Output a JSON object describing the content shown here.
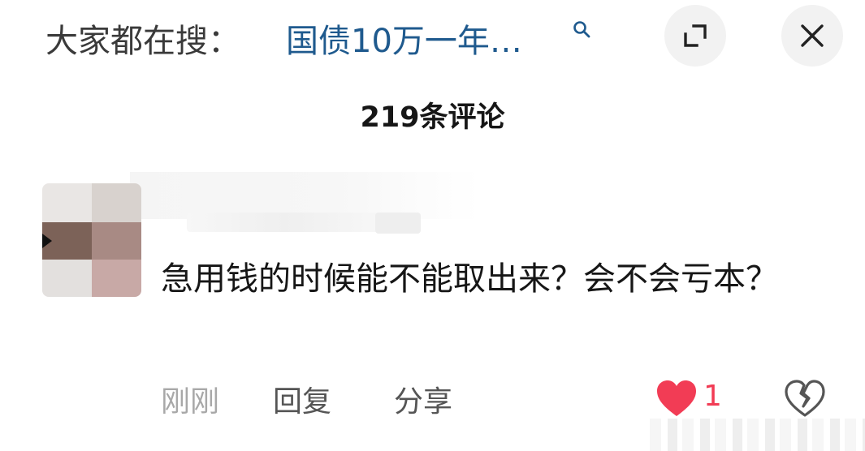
{
  "header": {
    "search_prefix": "大家都在搜：",
    "search_query": "国债10万一年…",
    "search_icon": "search-icon",
    "expand_icon": "expand-icon",
    "close_icon": "close-icon"
  },
  "comments_header": {
    "count_label": "219条评论"
  },
  "comment": {
    "avatar_icon": "avatar",
    "text": "急用钱的时候能不能取出来？会不会亏本？",
    "time": "刚刚",
    "reply_label": "回复",
    "share_label": "分享",
    "like_icon": "heart-icon",
    "like_count": "1",
    "dislike_icon": "broken-heart-icon"
  },
  "colors": {
    "search_query": "#1f5a8e",
    "like_red": "#f23c55",
    "button_bg": "#f2f2f2"
  }
}
